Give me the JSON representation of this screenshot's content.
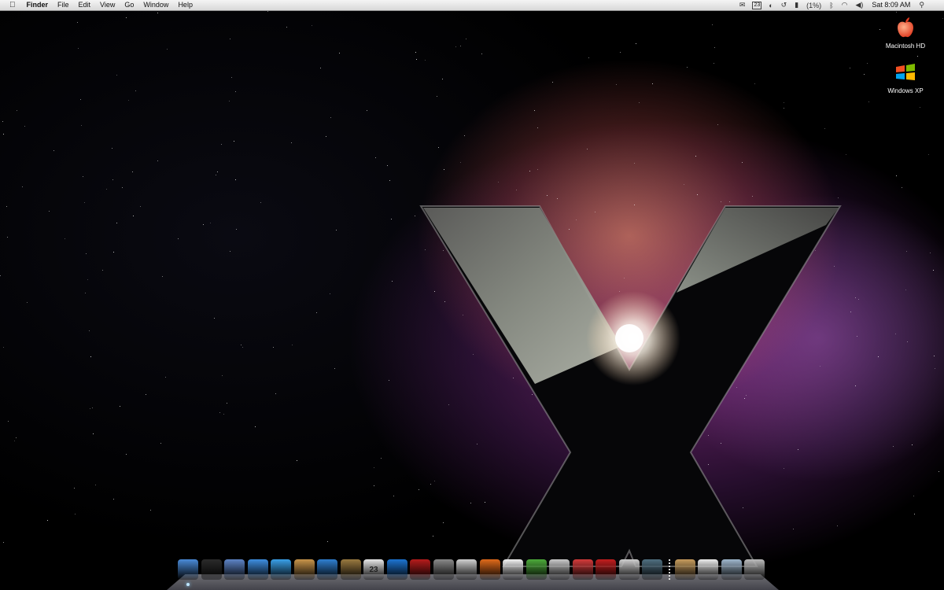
{
  "menubar": {
    "apple_glyph": "",
    "app_name": "Finder",
    "menus": [
      "File",
      "Edit",
      "View",
      "Go",
      "Window",
      "Help"
    ],
    "status": {
      "mail_icon": "mail-icon",
      "calendar_badge": "23",
      "time_machine_icon": "time-machine-icon",
      "battery_text": "(1%)",
      "wifi_icon": "wifi-icon",
      "volume_icon": "volume-icon",
      "clock": "Sat 8:09 AM",
      "spotlight_icon": "spotlight-icon"
    }
  },
  "desktop": {
    "icons": [
      {
        "name": "macintosh-hd",
        "label": "Macintosh HD",
        "icon": "apple-drive-icon"
      },
      {
        "name": "windows-xp",
        "label": "Windows XP",
        "icon": "windows-logo-icon"
      }
    ]
  },
  "dock": {
    "apps": [
      {
        "name": "finder",
        "icon": "finder-icon",
        "color": "#4a8bd8",
        "running": true
      },
      {
        "name": "dashboard",
        "icon": "dashboard-icon",
        "color": "#2b2b2b",
        "running": false
      },
      {
        "name": "mail",
        "icon": "mail-stamp-icon",
        "color": "#5d84c6",
        "running": false
      },
      {
        "name": "safari",
        "icon": "safari-compass-icon",
        "color": "#3e8ee0",
        "running": false
      },
      {
        "name": "ichat",
        "icon": "ichat-icon",
        "color": "#3aa0e8",
        "running": false
      },
      {
        "name": "address-book",
        "icon": "address-book-icon",
        "color": "#c8954a",
        "running": false
      },
      {
        "name": "itunes",
        "icon": "itunes-icon",
        "color": "#2f7fd0",
        "running": false
      },
      {
        "name": "iphoto",
        "icon": "iphoto-icon",
        "color": "#9a7a40",
        "running": false
      },
      {
        "name": "ical",
        "icon": "ical-icon",
        "color": "#e8e8e8",
        "running": false,
        "badge": "23"
      },
      {
        "name": "quicktime",
        "icon": "quicktime-icon",
        "color": "#1d74d1",
        "running": false
      },
      {
        "name": "photo-booth",
        "icon": "photo-booth-icon",
        "color": "#b51c1c",
        "running": false
      },
      {
        "name": "system-preferences",
        "icon": "gear-icon",
        "color": "#8a8a8a",
        "running": false
      },
      {
        "name": "movie-app",
        "icon": "film-icon",
        "color": "#d0d0d0",
        "running": false
      },
      {
        "name": "firefox",
        "icon": "firefox-icon",
        "color": "#e06a1b",
        "running": false
      },
      {
        "name": "adobe-reader",
        "icon": "pdf-icon",
        "color": "#f2f2f2",
        "running": false
      },
      {
        "name": "utility-app",
        "icon": "pushpin-icon",
        "color": "#4caa3a",
        "running": false
      },
      {
        "name": "app-store-like",
        "icon": "gift-box-icon",
        "color": "#c9c9c9",
        "running": false
      },
      {
        "name": "app-red",
        "icon": "red-app-icon",
        "color": "#d23a3a",
        "running": false
      },
      {
        "name": "app-swirl",
        "icon": "swirl-icon",
        "color": "#c21e1e",
        "running": false
      },
      {
        "name": "scissors-app",
        "icon": "scissors-icon",
        "color": "#cfcfcf",
        "running": false
      },
      {
        "name": "time-machine",
        "icon": "time-machine-icon",
        "color": "#4f6f80",
        "running": false
      }
    ],
    "docs": [
      {
        "name": "applications-stack",
        "icon": "applications-folder-icon",
        "color": "#c79c5d"
      },
      {
        "name": "documents-stack",
        "icon": "documents-icon",
        "color": "#ececec"
      },
      {
        "name": "downloads-stack",
        "icon": "downloads-folder-icon",
        "color": "#9fb7cd"
      },
      {
        "name": "trash",
        "icon": "trash-icon",
        "color": "#bcbcbc"
      }
    ]
  }
}
